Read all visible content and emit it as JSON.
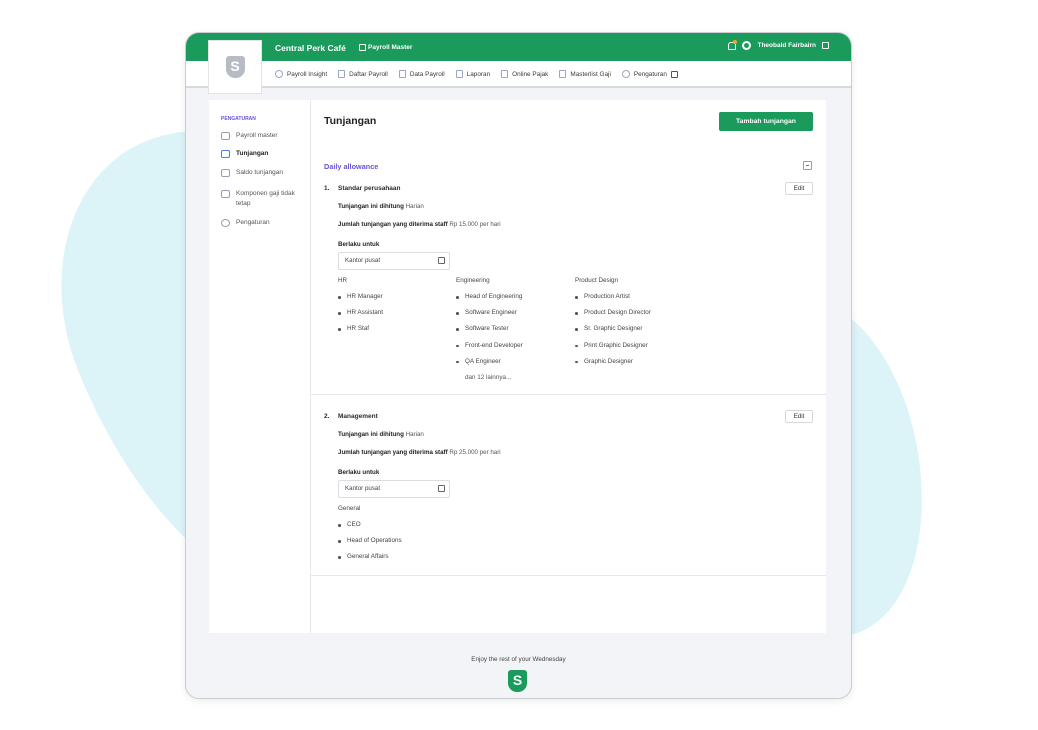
{
  "header": {
    "company": "Central Perk Café",
    "module": "Payroll Master",
    "user_name": "Theobald Fairbairn",
    "logo_letter": "S"
  },
  "nav": {
    "items": [
      {
        "label": "Payroll Insight",
        "icon": "gauge-icon"
      },
      {
        "label": "Daftar Payroll",
        "icon": "list-icon"
      },
      {
        "label": "Data Payroll",
        "icon": "data-icon"
      },
      {
        "label": "Laporan",
        "icon": "report-icon"
      },
      {
        "label": "Online Pajak",
        "icon": "bank-icon"
      },
      {
        "label": "Masterlist Gaji",
        "icon": "document-icon"
      },
      {
        "label": "Pengaturan",
        "icon": "gear-icon"
      }
    ]
  },
  "sidebar": {
    "title": "PENGATURAN",
    "items": [
      {
        "label": "Payroll master",
        "icon": "user-settings-icon",
        "active": false
      },
      {
        "label": "Tunjangan",
        "icon": "money-icon",
        "active": true
      },
      {
        "label": "Saldo tunjangan",
        "icon": "wallet-icon",
        "active": false
      },
      {
        "label": "Komponen gaji tidak tetap",
        "icon": "money-stack-icon",
        "active": false
      },
      {
        "label": "Pengaturan",
        "icon": "gear-icon",
        "active": false
      }
    ]
  },
  "main": {
    "title": "Tunjangan",
    "add_button": "Tambah tunjangan",
    "section_title": "Daily allowance",
    "edit_label": "Edit",
    "calc_label": "Tunjangan ini dihitung",
    "amount_label": "Jumlah tunjangan yang diterima staff",
    "applies_label": "Berlaku untuk",
    "allowances": [
      {
        "number": "1.",
        "name": "Standar perusahaan",
        "calc_value": "Harian",
        "amount_value": "Rp 15.000 per hari",
        "location": "Kantor pusat",
        "groups": [
          {
            "name": "HR",
            "roles": [
              "HR Manager",
              "HR Assistant",
              "HR Staf"
            ]
          },
          {
            "name": "Engineering",
            "roles": [
              "Head of Engineering",
              "Software Engineer",
              "Software Tester",
              "Front-end Developer",
              "QA Engineer"
            ],
            "more": "dan 12 lainnya..."
          },
          {
            "name": "Product Design",
            "roles": [
              "Production Artist",
              "Product Design Director",
              "Sr. Graphic Designer",
              "Print Graphic Designer",
              "Graphic Designer"
            ]
          }
        ]
      },
      {
        "number": "2.",
        "name": "Management",
        "calc_value": "Harian",
        "amount_value": "Rp 25.000 per hari",
        "location": "Kantor pusat",
        "groups": [
          {
            "name": "General",
            "roles": [
              "CEO",
              "Head of Operations",
              "General Affairs"
            ]
          }
        ]
      }
    ]
  },
  "footer": {
    "text": "Enjoy the rest of your Wednesday",
    "logo_letter": "S"
  },
  "colors": {
    "brand_green": "#1a9a5b",
    "accent_purple": "#6b52d6",
    "background_blob": "#dcf3f8"
  }
}
